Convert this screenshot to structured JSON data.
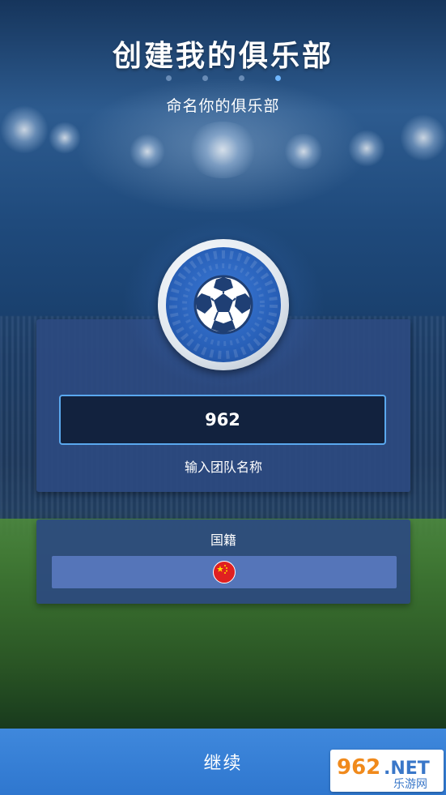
{
  "header": {
    "title": "创建我的俱乐部",
    "subtitle": "命名你的俱乐部",
    "steps_total": 4,
    "steps_active": 4
  },
  "club": {
    "emblem_icon": "soccer-ball-icon",
    "team_name_value": "962",
    "team_name_label": "输入团队名称"
  },
  "nationality": {
    "label": "国籍",
    "selected_flag_icon": "china-flag-icon"
  },
  "footer": {
    "continue_label": "继续"
  },
  "watermark": {
    "text_main": "962.NET",
    "text_sub": "乐游网"
  },
  "colors": {
    "accent_blue": "#3f88dc",
    "panel_blue": "#2c4a80",
    "input_border": "#5aa8ee",
    "active_dot": "#6fb6ff"
  }
}
